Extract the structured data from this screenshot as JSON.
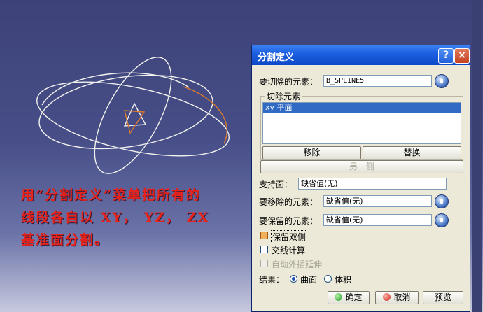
{
  "caption": {
    "line1": "用“分割定义”菜单把所有的",
    "line2": "线段各自以 XY， YZ， ZX",
    "line3": "基准面分割。"
  },
  "dialog": {
    "title": "分割定义",
    "help_label": "?",
    "close_label": "×",
    "cut_element_label": "要切除的元素：",
    "cut_element_value": "B_SPLINE5",
    "cutting_group_label": "切除元素",
    "cutting_list": [
      "xy 平面"
    ],
    "remove_label": "移除",
    "replace_label": "替换",
    "other_side_label": "另一侧",
    "support_label": "支持面：",
    "support_value": "缺省值(无)",
    "to_remove_label": "要移除的元素：",
    "to_remove_value": "缺省值(无)",
    "to_keep_label": "要保留的元素：",
    "to_keep_value": "缺省值(无)",
    "keep_both_label": "保留双侧",
    "intersection_label": "交线计算",
    "auto_extrapolate_label": "自动外插延伸",
    "result_label": "结果：",
    "result_surface": "曲面",
    "result_volume": "体积",
    "ok_label": "确定",
    "cancel_label": "取消",
    "preview_label": "预览",
    "accent_color": "#0d49c8"
  }
}
